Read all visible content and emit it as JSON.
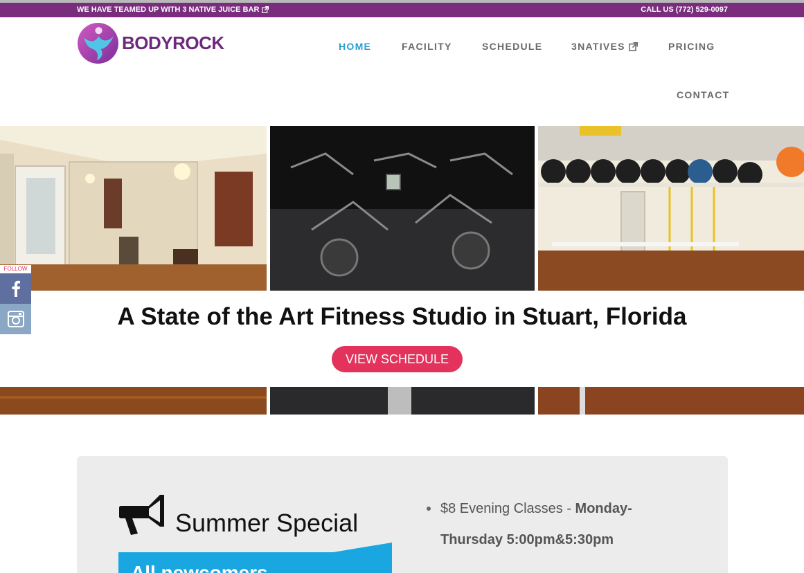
{
  "topbar": {
    "left_text": "WE HAVE TEAMED UP WITH 3 NATIVE JUICE BAR",
    "right_text": "CALL US (772) 529-0097",
    "bg_color": "#7a2c7d"
  },
  "logo": {
    "text": "BODYROCK"
  },
  "nav": {
    "home": "HOME",
    "facility": "FACILITY",
    "schedule": "SCHEDULE",
    "natives": "3NATIVES",
    "pricing": "PRICING",
    "contact": "CONTACT",
    "active_color": "#2a9fd0"
  },
  "hero": {
    "title": "A State of the Art Fitness Studio in Stuart, Florida",
    "cta": "VIEW SCHEDULE",
    "cta_color": "#e3325b"
  },
  "social": {
    "follow": "FOLLOW",
    "facebook_icon": "facebook-icon",
    "instagram_icon": "instagram-icon"
  },
  "promo": {
    "icon": "megaphone-icon",
    "title": "Summer Special",
    "ribbon_text": "All newcomers",
    "item_1_plain": "$8 Evening Classes - ",
    "item_1_bold_a": "Monday-",
    "item_1_bold_b": "Thursday 5:00pm&5:30pm"
  }
}
